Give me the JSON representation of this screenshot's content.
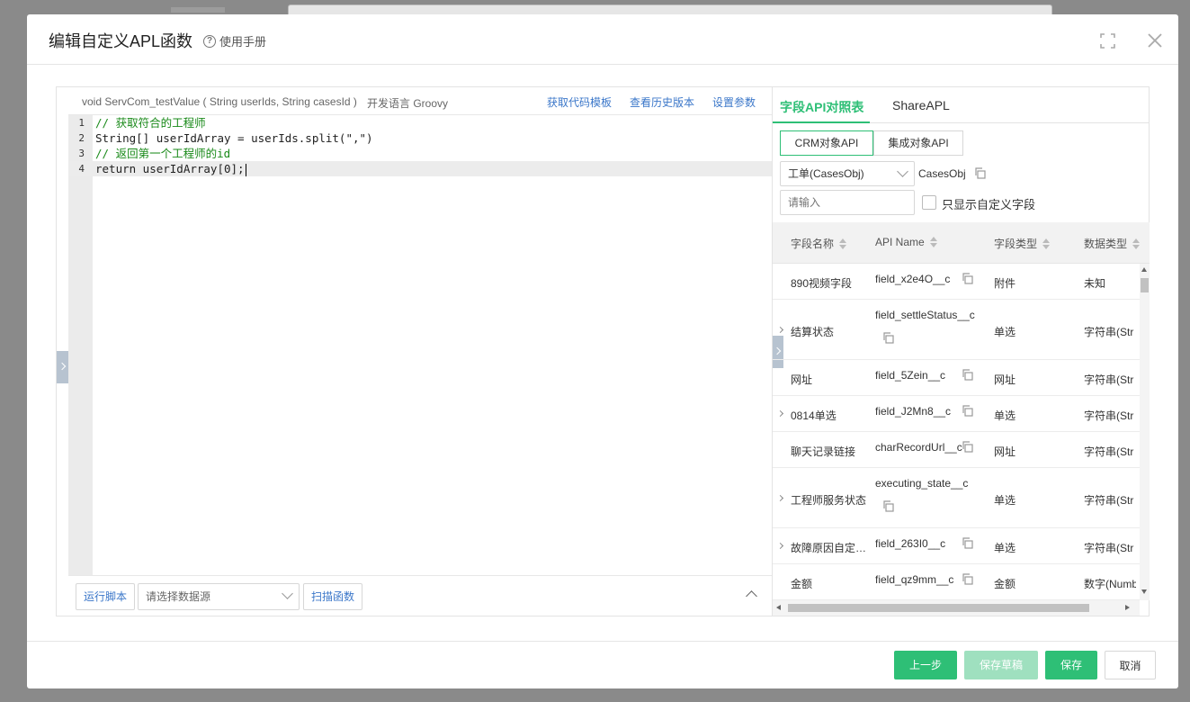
{
  "dialog": {
    "title": "编辑自定义APL函数",
    "manual_label": "使用手册",
    "help_icon_glyph": "?"
  },
  "editor": {
    "signature": "void ServCom_testValue ( String userIds, String casesId )",
    "language": "开发语言 Groovy",
    "links": {
      "template": "获取代码模板",
      "history": "查看历史版本",
      "params": "设置参数"
    },
    "lines": [
      {
        "num": "1",
        "text": "// 获取符合的工程师"
      },
      {
        "num": "2",
        "text": "String[] userIdArray = userIds.split(\",\")"
      },
      {
        "num": "3",
        "text": "// 返回第一个工程师的id"
      },
      {
        "num": "4",
        "text": "return userIdArray[0];"
      }
    ],
    "run_button": "运行脚本",
    "datasource_placeholder": "请选择数据源",
    "scan_button": "扫描函数"
  },
  "api_panel": {
    "tabs": [
      "字段API对照表",
      "ShareAPL"
    ],
    "segments": [
      "CRM对象API",
      "集成对象API"
    ],
    "object_select": "工单(CasesObj)",
    "object_api": "CasesObj",
    "search_placeholder": "请输入",
    "custom_only_label": "只显示自定义字段",
    "headers": [
      "字段名称",
      "API Name",
      "字段类型",
      "数据类型"
    ],
    "rows": [
      {
        "name": "890视频字段",
        "api": "field_x2e4O__c",
        "type": "附件",
        "dtype": "未知",
        "expandable": false,
        "wrap": false
      },
      {
        "name": "结算状态",
        "api": "field_settleStatus__c",
        "type": "单选",
        "dtype": "字符串(Str",
        "expandable": true,
        "wrap": true
      },
      {
        "name": "网址",
        "api": "field_5Zein__c",
        "type": "网址",
        "dtype": "字符串(Str",
        "expandable": false,
        "wrap": false
      },
      {
        "name": "0814单选",
        "api": "field_J2Mn8__c",
        "type": "单选",
        "dtype": "字符串(Str",
        "expandable": true,
        "wrap": false
      },
      {
        "name": "聊天记录链接",
        "api": "charRecordUrl__c",
        "type": "网址",
        "dtype": "字符串(Str",
        "expandable": false,
        "wrap": false
      },
      {
        "name": "工程师服务状态",
        "api": "executing_state__c",
        "type": "单选",
        "dtype": "字符串(Str",
        "expandable": true,
        "wrap": true
      },
      {
        "name": "故障原因自定…",
        "api": "field_263I0__c",
        "type": "单选",
        "dtype": "字符串(Str",
        "expandable": true,
        "wrap": false
      },
      {
        "name": "金额",
        "api": "field_qz9mm__c",
        "type": "金额",
        "dtype": "数字(Numb",
        "expandable": false,
        "wrap": false
      }
    ]
  },
  "footer": {
    "prev": "上一步",
    "save_draft": "保存草稿",
    "save": "保存",
    "cancel": "取消"
  },
  "colors": {
    "accent_green": "#2ebf76",
    "disabled_green": "#9fe0bf",
    "link_blue": "#3b77c9"
  }
}
